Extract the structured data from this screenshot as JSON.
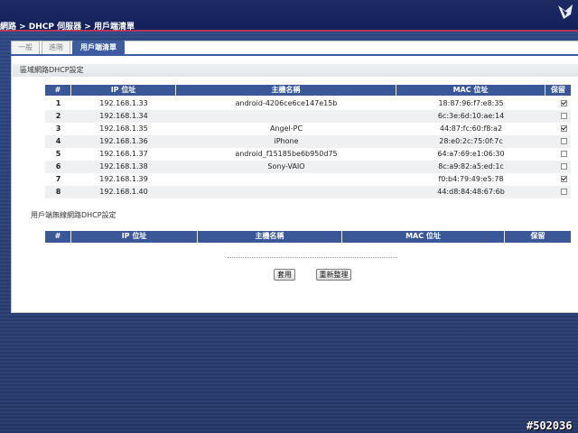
{
  "breadcrumb": "網路 > DHCP 伺服器 > 用戶端清單",
  "tabs": [
    {
      "label": "一般",
      "active": false
    },
    {
      "label": "進階",
      "active": false
    },
    {
      "label": "用戶端清單",
      "active": true
    }
  ],
  "lan_section": {
    "title": "區域網路DHCP設定",
    "columns": [
      "#",
      "IP 位址",
      "主機名稱",
      "MAC 位址",
      "保留"
    ],
    "rows": [
      {
        "num": "1",
        "ip": "192.168.1.33",
        "host": "android-4206ce6ce147e15b",
        "mac": "18:87:96:f7:e8:35",
        "reserve": true
      },
      {
        "num": "2",
        "ip": "192.168.1.34",
        "host": "",
        "mac": "6c:3e:6d:10:ae:14",
        "reserve": false
      },
      {
        "num": "3",
        "ip": "192.168.1.35",
        "host": "Angel-PC",
        "mac": "44:87:fc:60:f8:a2",
        "reserve": true
      },
      {
        "num": "4",
        "ip": "192.168.1.36",
        "host": "iPhone",
        "mac": "28:e0:2c:75:0f:7c",
        "reserve": false
      },
      {
        "num": "5",
        "ip": "192.168.1.37",
        "host": "android_f15185be6b950d75",
        "mac": "64:a7:69:e1:06:30",
        "reserve": false
      },
      {
        "num": "6",
        "ip": "192.168.1.38",
        "host": "Sony-VAIO",
        "mac": "8c:a9:82:a5:ed:1c",
        "reserve": false
      },
      {
        "num": "7",
        "ip": "192.168.1.39",
        "host": "",
        "mac": "f0:b4:79:49:e5:78",
        "reserve": true
      },
      {
        "num": "8",
        "ip": "192.168.1.40",
        "host": "",
        "mac": "44:d8:84:48:67:6b",
        "reserve": false
      }
    ]
  },
  "wireless_section": {
    "title": "用戶端無線網路DHCP設定",
    "columns": [
      "#",
      "IP 位址",
      "主機名稱",
      "MAC 位址",
      "保留"
    ]
  },
  "buttons": {
    "apply": "套用",
    "reset": "重新整理"
  },
  "watermark": "#502036",
  "colors": {
    "header_bg": "#3a5898",
    "accent_line": "#b33a5c",
    "topbar": "#14205a"
  }
}
